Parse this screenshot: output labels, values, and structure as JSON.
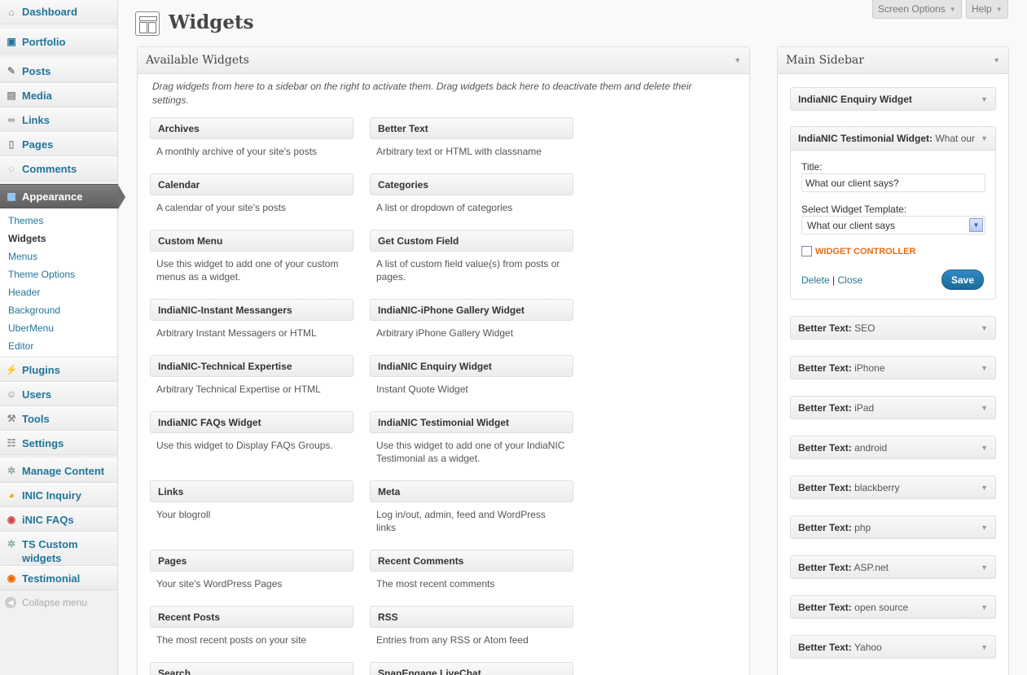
{
  "menu": {
    "dashboard": "Dashboard",
    "portfolio": "Portfolio",
    "posts": "Posts",
    "media": "Media",
    "links": "Links",
    "pages": "Pages",
    "comments": "Comments",
    "appearance": "Appearance",
    "appearance_sub": [
      "Themes",
      "Widgets",
      "Menus",
      "Theme Options",
      "Header",
      "Background",
      "UberMenu",
      "Editor"
    ],
    "plugins": "Plugins",
    "users": "Users",
    "tools": "Tools",
    "settings": "Settings",
    "manage_content": "Manage Content",
    "inic_inquiry": "INIC Inquiry",
    "inic_faqs": "iNIC FAQs",
    "ts_custom_widgets": "TS Custom widgets",
    "testimonial": "Testimonial",
    "collapse": "Collapse menu"
  },
  "header": {
    "title": "Widgets",
    "screen_options": "Screen Options",
    "help": "Help"
  },
  "available": {
    "title": "Available Widgets",
    "description": "Drag widgets from here to a sidebar on the right to activate them. Drag widgets back here to deactivate them and delete their settings.",
    "widgets": [
      {
        "title": "Archives",
        "desc": "A monthly archive of your site's posts"
      },
      {
        "title": "Better Text",
        "desc": "Arbitrary text or HTML with classname"
      },
      {
        "title": "Calendar",
        "desc": "A calendar of your site's posts"
      },
      {
        "title": "Categories",
        "desc": "A list or dropdown of categories"
      },
      {
        "title": "Custom Menu",
        "desc": "Use this widget to add one of your custom menus as a widget."
      },
      {
        "title": "Get Custom Field",
        "desc": "A list of custom field value(s) from posts or pages."
      },
      {
        "title": "IndiaNIC-Instant Messangers",
        "desc": "Arbitrary Instant Messagers or HTML"
      },
      {
        "title": "IndiaNIC-iPhone Gallery Widget",
        "desc": "Arbitrary iPhone Gallery Widget"
      },
      {
        "title": "IndiaNIC-Technical Expertise",
        "desc": "Arbitrary Technical Expertise or HTML"
      },
      {
        "title": "IndiaNIC Enquiry Widget",
        "desc": "Instant Quote Widget"
      },
      {
        "title": "IndiaNIC FAQs Widget",
        "desc": "Use this widget to Display FAQs Groups."
      },
      {
        "title": "IndiaNIC Testimonial Widget",
        "desc": "Use this widget to add one of your IndiaNIC Testimonial as a widget."
      },
      {
        "title": "Links",
        "desc": "Your blogroll"
      },
      {
        "title": "Meta",
        "desc": "Log in/out, admin, feed and WordPress links"
      },
      {
        "title": "Pages",
        "desc": "Your site's WordPress Pages"
      },
      {
        "title": "Recent Comments",
        "desc": "The most recent comments"
      },
      {
        "title": "Recent Posts",
        "desc": "The most recent posts on your site"
      },
      {
        "title": "RSS",
        "desc": "Entries from any RSS or Atom feed"
      },
      {
        "title": "Search",
        "desc": ""
      },
      {
        "title": "SnapEngage LiveChat",
        "desc": ""
      }
    ]
  },
  "sidebar": {
    "title": "Main Sidebar",
    "enquiry_widget": "IndiaNIC Enquiry Widget",
    "testimonial_widget": {
      "title": "IndiaNIC Testimonial Widget:",
      "name": "What our",
      "title_label": "Title:",
      "title_value": "What our client says?",
      "template_label": "Select Widget Template:",
      "template_value": "What our client says",
      "controller_label": "WIDGET CONTROLLER",
      "delete": "Delete",
      "separator": "|",
      "close": "Close",
      "save": "Save"
    },
    "better_text_label": "Better Text:",
    "better_text_items": [
      "SEO",
      "iPhone",
      "iPad",
      "android",
      "blackberry",
      "php",
      "ASP.net",
      "open source",
      "Yahoo"
    ]
  },
  "icons": {
    "dashboard": "dashboard-icon",
    "arrow": "down-arrow-icon"
  }
}
